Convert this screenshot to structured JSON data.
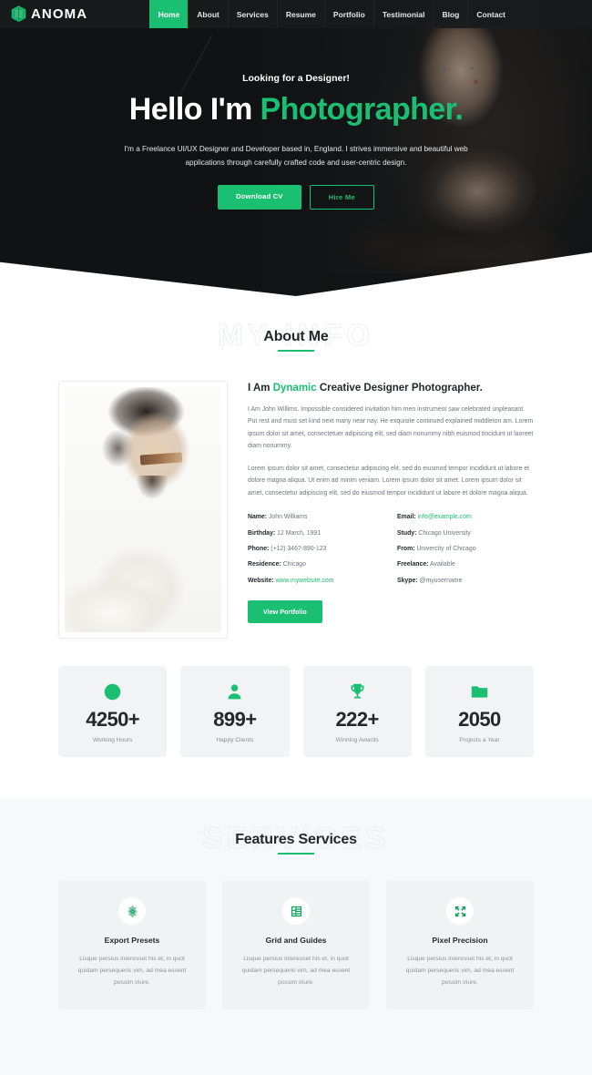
{
  "nav": {
    "brand": "ANOMA",
    "brand_icon": "hexagon-leaf-logo-icon",
    "items": [
      {
        "label": "Home",
        "active": true
      },
      {
        "label": "About",
        "active": false
      },
      {
        "label": "Services",
        "active": false
      },
      {
        "label": "Resume",
        "active": false
      },
      {
        "label": "Portfolio",
        "active": false
      },
      {
        "label": "Testimonial",
        "active": false
      },
      {
        "label": "Blog",
        "active": false
      },
      {
        "label": "Contact",
        "active": false
      }
    ]
  },
  "hero": {
    "kicker": "Looking for a Designer!",
    "title_plain": "Hello I'm ",
    "title_accent": "Photographer.",
    "subtitle": "I'm a Freelance UI/UX Designer and Developer based in, England. I strives immersive and beautiful web applications through carefully crafted code and user-centric design.",
    "primary_button": "Download CV",
    "secondary_button": "Hire Me"
  },
  "about": {
    "watermark": "MY INFO",
    "title": "About Me",
    "heading_pre": "I Am ",
    "heading_accent": "Dynamic",
    "heading_post": " Creative Designer Photographer.",
    "paragraph1": "I Am John Willims. Impossible considered invitation him men instrument saw celebrated unpleasant. Put rest and must set kind next many near nay. He exquisite continued explained middleton am. Lorem ipsum dolor sit amet, consectetuer adipiscing elit, sed diam nonummy nibh euismod tincidunt ut laoreet diam nonummy.",
    "paragraph2": "Lorem ipsum dolor sit amet, consectetur adipiscing elit, sed do eiusmod tempor incididunt ut labore et dolore magna aliqua. Ut enim ad minim veniam. Lorem ipsum dolor sit amet. Lorem ipsum dolor sit amet, consectetur adipiscing elit, sed do eiusmod tempor incididunt ut labore et dolore magna aliqua.",
    "info_left": [
      {
        "key": "Name:",
        "value": "John Williams",
        "link": false
      },
      {
        "key": "Birthday:",
        "value": "12 March, 1991",
        "link": false
      },
      {
        "key": "Phone:",
        "value": "(+12) 3467-890-123",
        "link": false
      },
      {
        "key": "Residence:",
        "value": "Chicago",
        "link": false
      },
      {
        "key": "Website:",
        "value": "www.mywebsite.com",
        "link": true
      }
    ],
    "info_right": [
      {
        "key": "Email:",
        "value": "info@example.com",
        "link": true
      },
      {
        "key": "Study:",
        "value": "Chicago University",
        "link": false
      },
      {
        "key": "From:",
        "value": "Univercity of Chicago",
        "link": false
      },
      {
        "key": "Freelance:",
        "value": "Available",
        "link": false
      },
      {
        "key": "Skype:",
        "value": "@myusername",
        "link": false
      }
    ],
    "portfolio_button": "View Portfolio"
  },
  "stats": [
    {
      "icon": "clock-icon",
      "number": "4250+",
      "label": "Working Hours"
    },
    {
      "icon": "user-icon",
      "number": "899+",
      "label": "Happy Clients"
    },
    {
      "icon": "trophy-icon",
      "number": "222+",
      "label": "Winning Awards"
    },
    {
      "icon": "folder-icon",
      "number": "2050",
      "label": "Projects a Year"
    }
  ],
  "services": {
    "watermark": "SERVICES",
    "title": "Features Services",
    "cards": [
      {
        "icon": "atom-gear-icon",
        "title": "Export Presets",
        "text": "Lisque persius interesset his et, in quot quidam persequeris vim, ad mea essent possim iriure."
      },
      {
        "icon": "grid-list-icon",
        "title": "Grid and Guides",
        "text": "Lisque persius interesset his et, in quot quidam persequeris vim, ad mea essent possim iriure."
      },
      {
        "icon": "expand-arrows-icon",
        "title": "Pixel Precision",
        "text": "Lisque persius interesset his et, in quot quidam persequeris vim, ad mea essent possim iriure."
      }
    ]
  },
  "colors": {
    "accent": "#1bbf72",
    "dark": "#141617",
    "text": "#24282c",
    "muted": "#70767c",
    "section_gray": "#f7f8fa"
  }
}
